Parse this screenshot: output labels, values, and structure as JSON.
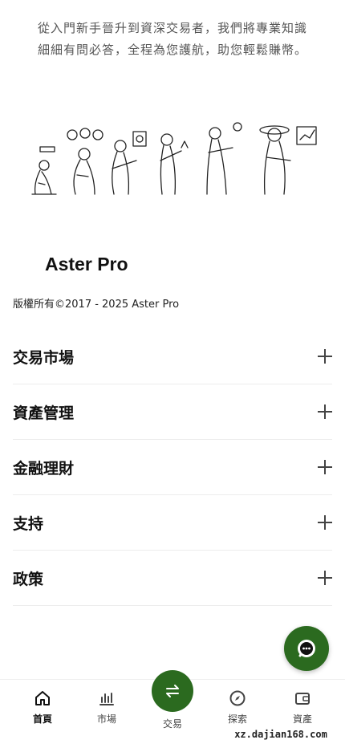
{
  "intro": {
    "text": "從入門新手晉升到資深交易者，我們將專業知識細細有問必答，全程為您護航，助您輕鬆賺幣。"
  },
  "brand": {
    "name": "Aster Pro",
    "copyright": "版權所有©2017 - 2025 Aster Pro"
  },
  "accordion": [
    {
      "label": "交易市場"
    },
    {
      "label": "資產管理"
    },
    {
      "label": "金融理財"
    },
    {
      "label": "支持"
    },
    {
      "label": "政策"
    }
  ],
  "bottom_nav": {
    "home": "首頁",
    "market": "市場",
    "trade": "交易",
    "explore": "探索",
    "assets": "資產"
  },
  "watermark": "xz.dajian168.com",
  "colors": {
    "accent": "#2b6a1f"
  },
  "icons": [
    "home-icon",
    "market-chart-icon",
    "swap-arrows-icon",
    "compass-icon",
    "wallet-icon",
    "chat-bubble-icon",
    "plus-icon"
  ]
}
